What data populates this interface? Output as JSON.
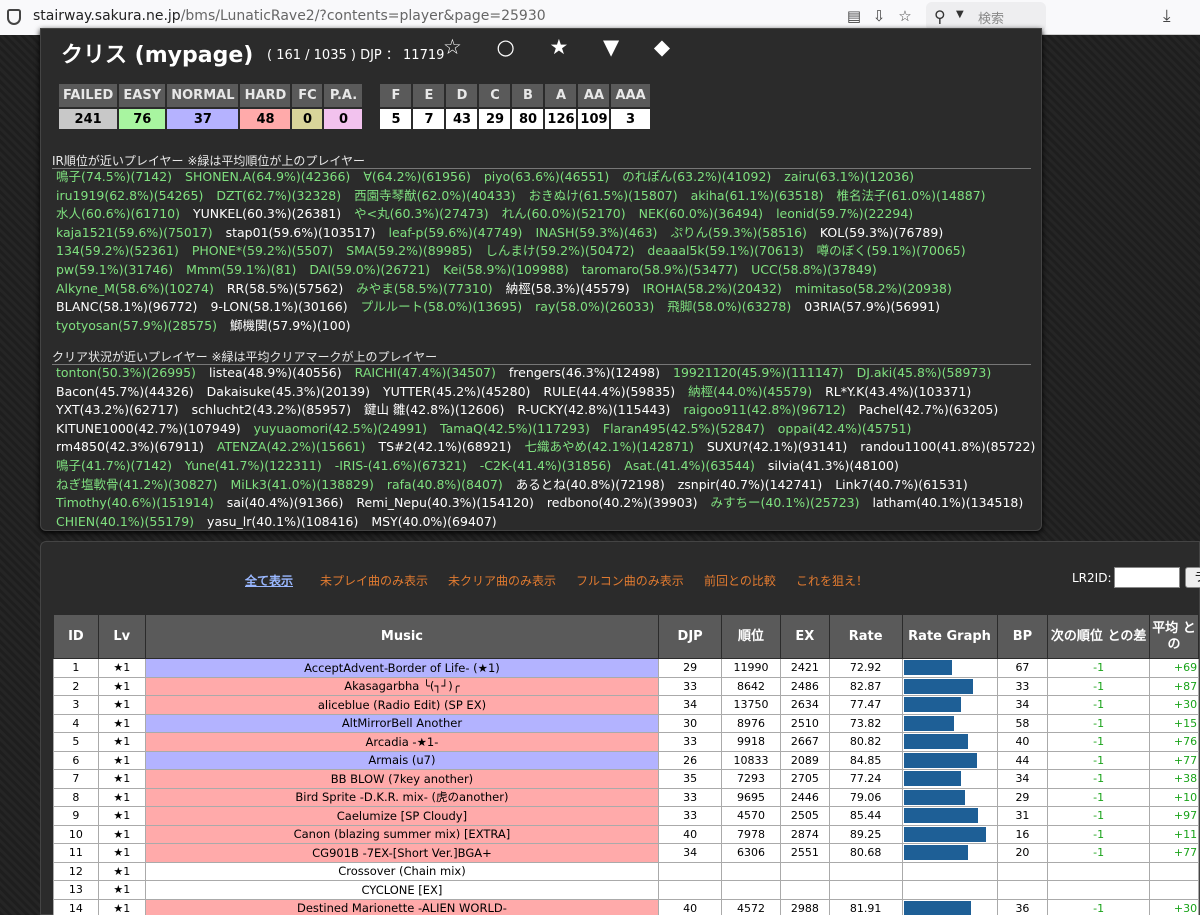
{
  "browser": {
    "url_domain": "stairway.sakura.ne.jp",
    "url_path": "/bms/LunaticRave2/?contents=player&page=25930",
    "search_placeholder": "検索"
  },
  "profile": {
    "name": "クリス (mypage)",
    "stats": "( 161 / 1035 ) DJP ： 11719",
    "marks": "☆ ○ ★ ▼ ◆"
  },
  "lamps": {
    "headers": [
      "FAILED",
      "EASY",
      "NORMAL",
      "HARD",
      "FC",
      "P.A."
    ],
    "values": [
      "241",
      "76",
      "37",
      "48",
      "0",
      "0"
    ],
    "colors": [
      "#c8c8c8",
      "#a8f5a0",
      "#b5b2ff",
      "#ffaaaa",
      "#d9d59a",
      "#f2c2ee"
    ]
  },
  "ranks": {
    "headers": [
      "F",
      "E",
      "D",
      "C",
      "B",
      "A",
      "AA",
      "AAA"
    ],
    "values": [
      "5",
      "7",
      "43",
      "29",
      "80",
      "126",
      "109",
      "3"
    ]
  },
  "ir_section": {
    "title": "IR順位が近いプレイヤー ※緑は平均順位が上のプレイヤー",
    "rows": [
      [
        [
          "g",
          "鳴子(74.5%)(7142)"
        ],
        [
          "g",
          "SHONEN.A(64.9%)(42366)"
        ],
        [
          "g",
          "∀(64.2%)(61956)"
        ],
        [
          "g",
          "piyo(63.6%)(46551)"
        ],
        [
          "g",
          "のれぽん(63.2%)(41092)"
        ],
        [
          "g",
          "zairu(63.1%)(12036)"
        ]
      ],
      [
        [
          "g",
          "iru1919(62.8%)(54265)"
        ],
        [
          "g",
          "DZT(62.7%)(32328)"
        ],
        [
          "g",
          "西園寺琴猷(62.0%)(40433)"
        ],
        [
          "g",
          "おきぬけ(61.5%)(15807)"
        ],
        [
          "g",
          "akiha(61.1%)(63518)"
        ],
        [
          "g",
          "椎名法子(61.0%)(14887)"
        ]
      ],
      [
        [
          "g",
          "水人(60.6%)(61710)"
        ],
        [
          "w",
          "YUNKEL(60.3%)(26381)"
        ],
        [
          "g",
          "や<丸(60.3%)(27473)"
        ],
        [
          "g",
          "れん(60.0%)(52170)"
        ],
        [
          "g",
          "NEK(60.0%)(36494)"
        ],
        [
          "g",
          "leonid(59.7%)(22294)"
        ]
      ],
      [
        [
          "g",
          "kaja1521(59.6%)(75017)"
        ],
        [
          "w",
          "stap01(59.6%)(103517)"
        ],
        [
          "g",
          "leaf-p(59.6%)(47749)"
        ],
        [
          "g",
          "INASH(59.3%)(463)"
        ],
        [
          "g",
          "ぷりん(59.3%)(58516)"
        ],
        [
          "w",
          "KOL(59.3%)(76789)"
        ]
      ],
      [
        [
          "g",
          "134(59.2%)(52361)"
        ],
        [
          "g",
          "PHONE*(59.2%)(5507)"
        ],
        [
          "g",
          "SMA(59.2%)(89985)"
        ],
        [
          "g",
          "しんまけ(59.2%)(50472)"
        ],
        [
          "g",
          "deaaal5k(59.1%)(70613)"
        ],
        [
          "g",
          "噂のぼく(59.1%)(70065)"
        ]
      ],
      [
        [
          "g",
          "pw(59.1%)(31746)"
        ],
        [
          "g",
          "Mmm(59.1%)(81)"
        ],
        [
          "g",
          "DAI(59.0%)(26721)"
        ],
        [
          "g",
          "Kei(58.9%)(109988)"
        ],
        [
          "g",
          "taromaro(58.9%)(53477)"
        ],
        [
          "g",
          "UCC(58.8%)(37849)"
        ]
      ],
      [
        [
          "g",
          "Alkyne_M(58.6%)(10274)"
        ],
        [
          "w",
          "RR(58.5%)(57562)"
        ],
        [
          "g",
          "みやま(58.5%)(77310)"
        ],
        [
          "w",
          "納桱(58.3%)(45579)"
        ],
        [
          "g",
          "IROHA(58.2%)(20432)"
        ],
        [
          "g",
          "mimitaso(58.2%)(20938)"
        ]
      ],
      [
        [
          "w",
          "BLANC(58.1%)(96772)"
        ],
        [
          "w",
          "9-LON(58.1%)(30166)"
        ],
        [
          "g",
          "プルルート(58.0%)(13695)"
        ],
        [
          "g",
          "ray(58.0%)(26033)"
        ],
        [
          "g",
          "飛脚(58.0%)(63278)"
        ],
        [
          "w",
          "03RIA(57.9%)(56991)"
        ]
      ],
      [
        [
          "g",
          "tyotyosan(57.9%)(28575)"
        ],
        [
          "w",
          "鰤機関(57.9%)(100)"
        ]
      ]
    ]
  },
  "clear_section": {
    "title": "クリア状況が近いプレイヤー ※緑は平均クリアマークが上のプレイヤー",
    "rows": [
      [
        [
          "g",
          "tonton(50.3%)(26995)"
        ],
        [
          "w",
          "listea(48.9%)(40556)"
        ],
        [
          "g",
          "RAICHI(47.4%)(34507)"
        ],
        [
          "w",
          "frengers(46.3%)(12498)"
        ],
        [
          "g",
          "19921120(45.9%)(111147)"
        ],
        [
          "g",
          "DJ.aki(45.8%)(58973)"
        ]
      ],
      [
        [
          "w",
          "Bacon(45.7%)(44326)"
        ],
        [
          "w",
          "Dakaisuke(45.3%)(20139)"
        ],
        [
          "w",
          "YUTTER(45.2%)(45280)"
        ],
        [
          "w",
          "RULE(44.4%)(59835)"
        ],
        [
          "g",
          "納桱(44.0%)(45579)"
        ],
        [
          "w",
          "RL*Y.K(43.4%)(103371)"
        ]
      ],
      [
        [
          "w",
          "YXT(43.2%)(62717)"
        ],
        [
          "w",
          "schlucht2(43.2%)(85957)"
        ],
        [
          "w",
          "鍵山 雛(42.8%)(12606)"
        ],
        [
          "w",
          "R-UCKY(42.8%)(115443)"
        ],
        [
          "g",
          "raigoo911(42.8%)(96712)"
        ],
        [
          "w",
          "Pachel(42.7%)(63205)"
        ]
      ],
      [
        [
          "w",
          "KITUNE1000(42.7%)(107949)"
        ],
        [
          "g",
          "yuyuaomori(42.5%)(24991)"
        ],
        [
          "g",
          "TamaQ(42.5%)(117293)"
        ],
        [
          "g",
          "Flaran495(42.5%)(52847)"
        ],
        [
          "g",
          "oppai(42.4%)(45751)"
        ]
      ],
      [
        [
          "w",
          "rm4850(42.3%)(67911)"
        ],
        [
          "g",
          "ATENZA(42.2%)(15661)"
        ],
        [
          "w",
          "TS#2(42.1%)(68921)"
        ],
        [
          "g",
          "七織あやめ(42.1%)(142871)"
        ],
        [
          "w",
          "SUXU?(42.1%)(93141)"
        ],
        [
          "w",
          "randou1100(41.8%)(85722)"
        ]
      ],
      [
        [
          "g",
          "鳴子(41.7%)(7142)"
        ],
        [
          "g",
          "Yune(41.7%)(122311)"
        ],
        [
          "g",
          "-IRIS-(41.6%)(67321)"
        ],
        [
          "g",
          "-C2K-(41.4%)(31856)"
        ],
        [
          "g",
          "Asat.(41.4%)(63544)"
        ],
        [
          "w",
          "silvia(41.3%)(48100)"
        ]
      ],
      [
        [
          "g",
          "ねぎ塩軟骨(41.2%)(30827)"
        ],
        [
          "g",
          "MiLk3(41.0%)(138829)"
        ],
        [
          "g",
          "rafa(40.8%)(8407)"
        ],
        [
          "w",
          "あるとね(40.8%)(72198)"
        ],
        [
          "w",
          "zsnpir(40.7%)(142741)"
        ],
        [
          "w",
          "Link7(40.7%)(61531)"
        ]
      ],
      [
        [
          "g",
          "Timothy(40.6%)(151914)"
        ],
        [
          "w",
          "sai(40.4%)(91366)"
        ],
        [
          "w",
          "Remi_Nepu(40.3%)(154120)"
        ],
        [
          "w",
          "redbono(40.2%)(39903)"
        ],
        [
          "g",
          "みすちー(40.1%)(25723)"
        ],
        [
          "w",
          "latham(40.1%)(134518)"
        ]
      ],
      [
        [
          "g",
          "CHIEN(40.1%)(55179)"
        ],
        [
          "w",
          "yasu_lr(40.1%)(108416)"
        ],
        [
          "w",
          "MSY(40.0%)(69407)"
        ]
      ]
    ]
  },
  "nav": {
    "show_all": "全て表示",
    "unplayed": "未プレイ曲のみ表示",
    "uncleared": "未クリア曲のみ表示",
    "fullcombo": "フルコン曲のみ表示",
    "compare": "前回との比較",
    "target": "これを狙え！",
    "lr2id_label": "LR2ID:",
    "lr2id_button": "ラ"
  },
  "table": {
    "headers": [
      "ID",
      "Lv",
      "Music",
      "DJP",
      "順位",
      "EX",
      "Rate",
      "Rate Graph",
      "BP",
      "次の順位 との差",
      "平均 との"
    ],
    "rows": [
      {
        "id": "1",
        "lv": "★1",
        "title": "AcceptAdvent-Border of Life- (★1)",
        "color": "#b3b3ff",
        "djp": "29",
        "rank": "11990",
        "ex": "2421",
        "rate": "72.92",
        "bp": "67",
        "diff": "-1",
        "avg": "+69",
        "fill": 0.729
      },
      {
        "id": "2",
        "lv": "★1",
        "title": "Akasagarbha ╰(┐┘)╭",
        "color": "#ffaaaa",
        "djp": "33",
        "rank": "8642",
        "ex": "2486",
        "rate": "82.87",
        "bp": "33",
        "diff": "-1",
        "avg": "+87",
        "fill": 0.829
      },
      {
        "id": "3",
        "lv": "★1",
        "title": "aliceblue (Radio Edit) (SP EX)",
        "color": "#ffaaaa",
        "djp": "34",
        "rank": "13750",
        "ex": "2634",
        "rate": "77.47",
        "bp": "34",
        "diff": "-1",
        "avg": "+30",
        "fill": 0.775
      },
      {
        "id": "4",
        "lv": "★1",
        "title": "AltMirrorBell Another",
        "color": "#b3b3ff",
        "djp": "30",
        "rank": "8976",
        "ex": "2510",
        "rate": "73.82",
        "bp": "58",
        "diff": "-1",
        "avg": "+15",
        "fill": 0.738
      },
      {
        "id": "5",
        "lv": "★1",
        "title": "Arcadia -★1-",
        "color": "#ffaaaa",
        "djp": "33",
        "rank": "9918",
        "ex": "2667",
        "rate": "80.82",
        "bp": "40",
        "diff": "-1",
        "avg": "+76",
        "fill": 0.808
      },
      {
        "id": "6",
        "lv": "★1",
        "title": "Armais (u7)",
        "color": "#b3b3ff",
        "djp": "26",
        "rank": "10833",
        "ex": "2089",
        "rate": "84.85",
        "bp": "44",
        "diff": "-1",
        "avg": "+77",
        "fill": 0.849
      },
      {
        "id": "7",
        "lv": "★1",
        "title": "BB BLOW (7key another)",
        "color": "#ffaaaa",
        "djp": "35",
        "rank": "7293",
        "ex": "2705",
        "rate": "77.24",
        "bp": "34",
        "diff": "-1",
        "avg": "+38",
        "fill": 0.772
      },
      {
        "id": "8",
        "lv": "★1",
        "title": "Bird Sprite -D.K.R. mix- (虎のanother)",
        "color": "#ffaaaa",
        "djp": "33",
        "rank": "9695",
        "ex": "2446",
        "rate": "79.06",
        "bp": "29",
        "diff": "-1",
        "avg": "+10",
        "fill": 0.791
      },
      {
        "id": "9",
        "lv": "★1",
        "title": "Caelumize [SP Cloudy]",
        "color": "#ffaaaa",
        "djp": "33",
        "rank": "4570",
        "ex": "2505",
        "rate": "85.44",
        "bp": "31",
        "diff": "-1",
        "avg": "+97",
        "fill": 0.854
      },
      {
        "id": "10",
        "lv": "★1",
        "title": "Canon (blazing summer mix) [EXTRA]",
        "color": "#ffaaaa",
        "djp": "40",
        "rank": "7978",
        "ex": "2874",
        "rate": "89.25",
        "bp": "16",
        "diff": "-1",
        "avg": "+11",
        "fill": 0.893
      },
      {
        "id": "11",
        "lv": "★1",
        "title": "CG901B -7EX-[Short Ver.]BGA+",
        "color": "#ffaaaa",
        "djp": "34",
        "rank": "6306",
        "ex": "2551",
        "rate": "80.68",
        "bp": "20",
        "diff": "-1",
        "avg": "+77",
        "fill": 0.807
      },
      {
        "id": "12",
        "lv": "★1",
        "title": "Crossover (Chain mix)",
        "color": "#ffffff",
        "djp": "",
        "rank": "",
        "ex": "",
        "rate": "",
        "bp": "",
        "diff": "",
        "avg": "",
        "fill": 0
      },
      {
        "id": "13",
        "lv": "★1",
        "title": "CYCLONE [EX]",
        "color": "#ffffff",
        "djp": "",
        "rank": "",
        "ex": "",
        "rate": "",
        "bp": "",
        "diff": "",
        "avg": "",
        "fill": 0
      },
      {
        "id": "14",
        "lv": "★1",
        "title": "Destined Marionette -ALIEN WORLD-",
        "color": "#ffaaaa",
        "djp": "40",
        "rank": "4572",
        "ex": "2988",
        "rate": "81.91",
        "bp": "36",
        "diff": "-1",
        "avg": "+30",
        "fill": 0.819
      }
    ]
  },
  "colors": {
    "green_text": "#7fe07f",
    "bar": "#1e5f96",
    "nav_orange": "#e07a30",
    "nav_selected": "#9ab8ff"
  }
}
